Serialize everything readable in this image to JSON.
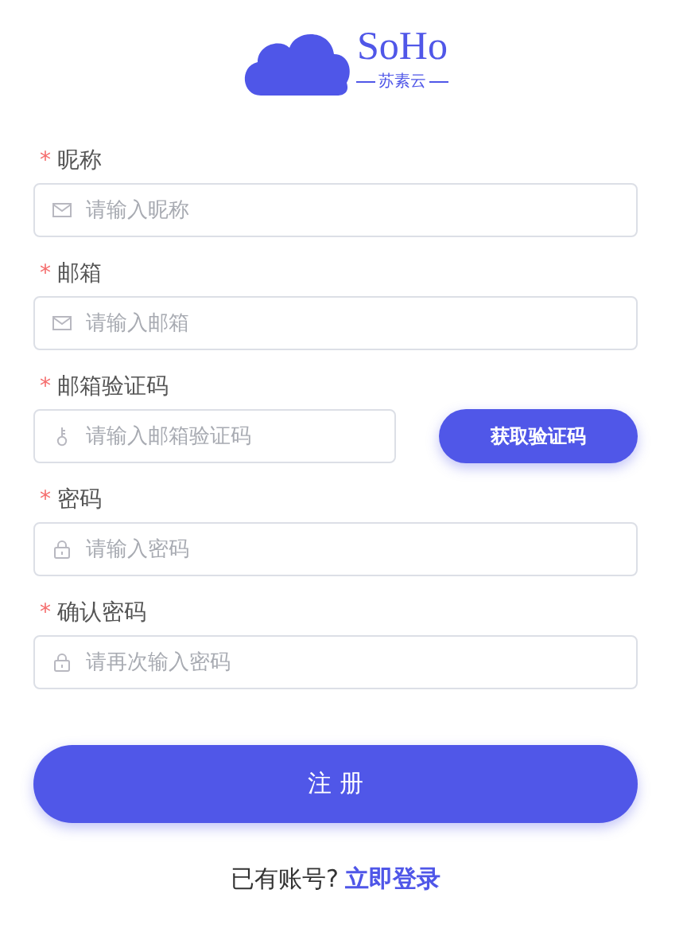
{
  "logo": {
    "name": "SoHo",
    "subtitle": "苏素云"
  },
  "fields": [
    {
      "label": "昵称",
      "required_mark": "*",
      "kind": "mail",
      "placeholder": "请输入昵称"
    },
    {
      "label": "邮箱",
      "required_mark": "*",
      "kind": "mail",
      "placeholder": "请输入邮箱"
    },
    {
      "label": "邮箱验证码",
      "required_mark": "*",
      "kind": "key",
      "placeholder": "请输入邮箱验证码",
      "button": "获取验证码"
    },
    {
      "label": "密码",
      "required_mark": "*",
      "kind": "lock",
      "placeholder": "请输入密码"
    },
    {
      "label": "确认密码",
      "required_mark": "*",
      "kind": "lock",
      "placeholder": "请再次输入密码"
    }
  ],
  "submit": "注 册",
  "footer": {
    "text": "已有账号?",
    "link": "立即登录"
  }
}
